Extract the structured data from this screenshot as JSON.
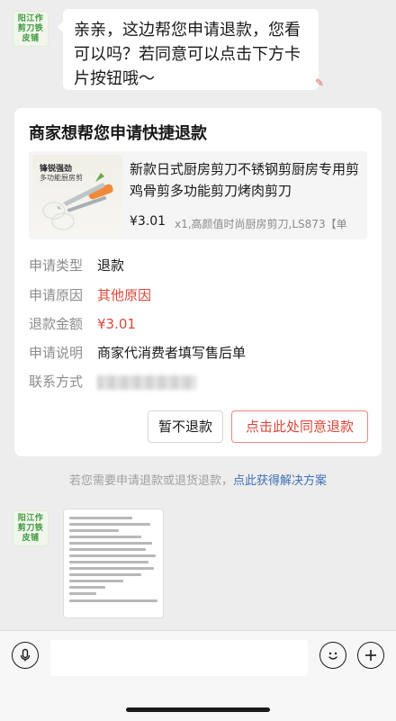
{
  "avatar": {
    "line1": "阳江作",
    "line2": "剪刀铁",
    "line3": "皮铺"
  },
  "message": {
    "text": "亲亲，这边帮您申请退款，您看可以吗？若同意可以点击下方卡片按钮哦～"
  },
  "refund_card": {
    "title": "商家想帮您申请快捷退款",
    "product": {
      "image_tag1": "锋锐强劲",
      "image_tag2": "多功能厨房剪",
      "title": "新款日式厨房剪刀不锈钢剪厨房专用剪鸡骨剪多功能剪刀烤肉剪刀",
      "price": "¥3.01",
      "spec": "x1,高颜值时尚厨房剪刀,LS873【单"
    },
    "rows": [
      {
        "key": "申请类型",
        "value": "退款"
      },
      {
        "key": "申请原因",
        "value": "其他原因"
      },
      {
        "key": "退款金额",
        "value": "¥3.01"
      },
      {
        "key": "申请说明",
        "value": "商家代消费者填写售后单"
      },
      {
        "key": "联系方式",
        "value": ""
      }
    ],
    "reject_button": "暂不退款",
    "agree_button": "点击此处同意退款"
  },
  "hint": {
    "text": "若您需要申请退款或退货退款，",
    "link": "点此获得解决方案"
  },
  "colors": {
    "accent_red": "#d8483a",
    "link_blue": "#3f6fb8",
    "background": "#ededed"
  },
  "icons": {
    "voice": "voice-icon",
    "emoji": "emoji-icon",
    "plus": "plus-icon"
  }
}
